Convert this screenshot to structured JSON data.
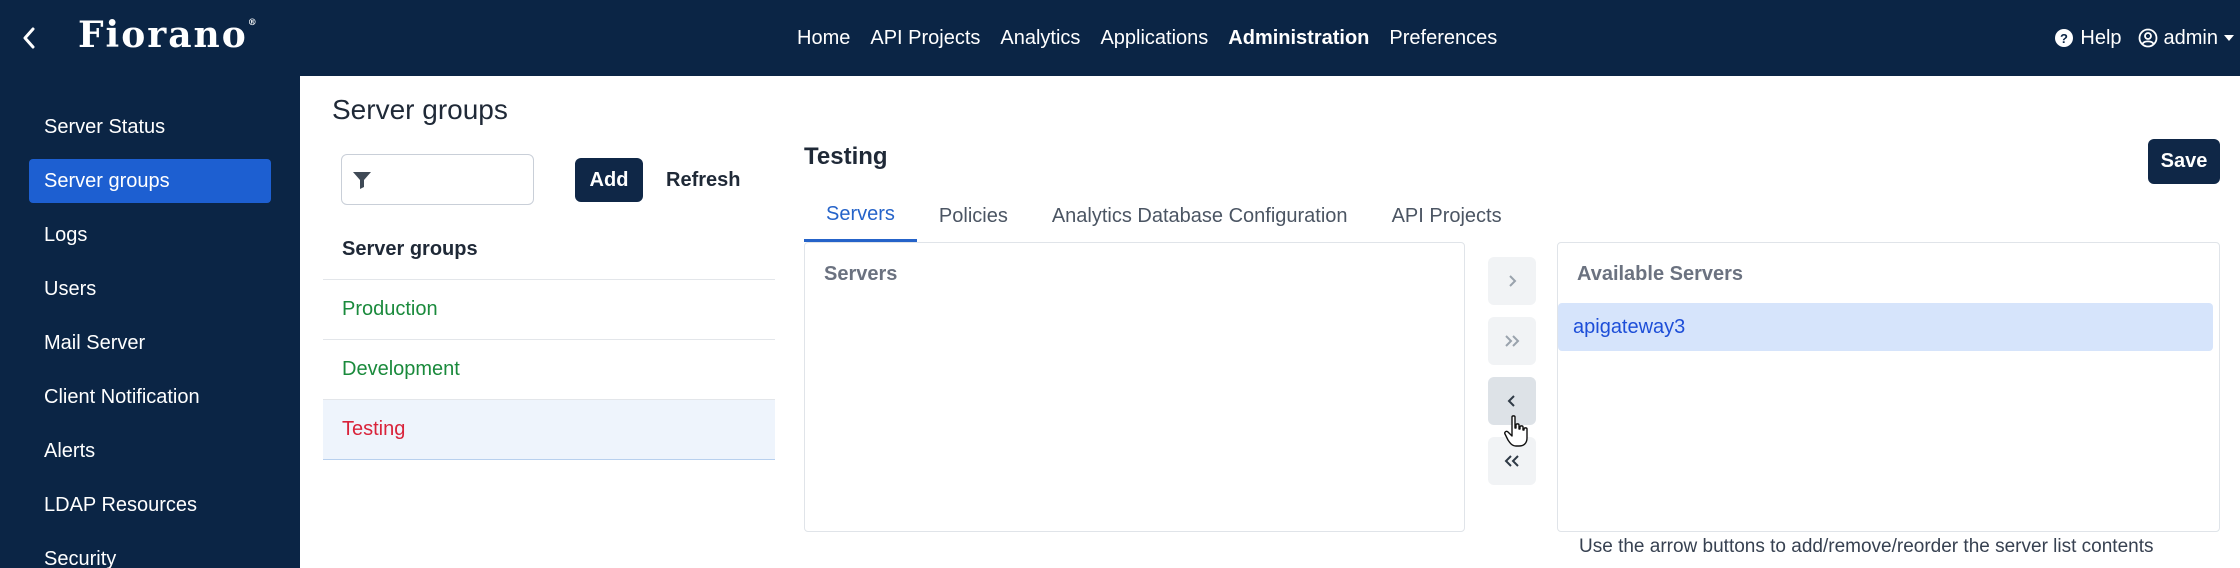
{
  "navbar": {
    "logo": "Fiorano",
    "logo_mark": "®",
    "items": [
      "Home",
      "API Projects",
      "Analytics",
      "Applications",
      "Administration",
      "Preferences"
    ],
    "active": "Administration",
    "help_label": "Help",
    "user_label": "admin"
  },
  "sidebar": {
    "items": [
      "Server Status",
      "Server groups",
      "Logs",
      "Users",
      "Mail Server",
      "Client Notification",
      "Alerts",
      "LDAP Resources",
      "Security"
    ],
    "active": "Server groups"
  },
  "page": {
    "title": "Server groups",
    "filter_placeholder": "",
    "add_label": "Add",
    "refresh_label": "Refresh"
  },
  "group_list": {
    "header": "Server groups",
    "items": [
      "Production",
      "Development",
      "Testing"
    ],
    "selected": "Testing"
  },
  "detail": {
    "title": "Testing",
    "save_label": "Save",
    "tabs": [
      "Servers",
      "Policies",
      "Analytics Database Configuration",
      "API Projects"
    ],
    "active_tab": "Servers",
    "servers_header": "Servers",
    "available_header": "Available Servers",
    "available_items": [
      "apigateway3"
    ],
    "hint": "Use the arrow buttons to add/remove/reorder the server list contents"
  },
  "colors": {
    "navy": "#0b2545",
    "accent_blue": "#1d5fd1",
    "success_green": "#1a8a3c",
    "selected_red": "#d9233a"
  }
}
